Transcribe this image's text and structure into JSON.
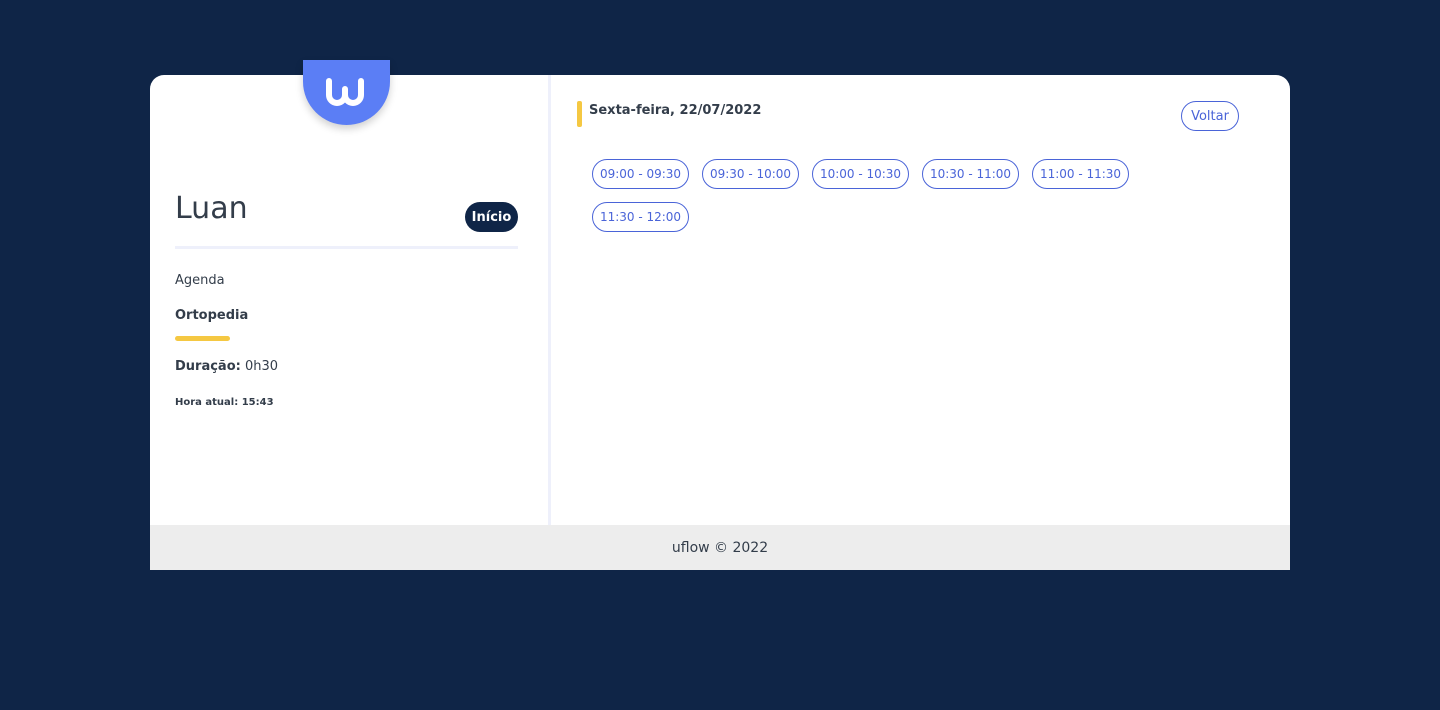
{
  "logo": {
    "icon": "uflow-logo-icon",
    "color": "#5b7ef5"
  },
  "sidebar": {
    "user_name": "Luan",
    "home_button_label": "Início",
    "agenda_label": "Agenda",
    "specialty": "Ortopedia",
    "duration_label": "Duração:",
    "duration_value": "0h30",
    "current_time": "Hora atual: 15:43"
  },
  "schedule": {
    "date": "Sexta-feira, 22/07/2022",
    "back_label": "Voltar",
    "slots": [
      {
        "label": "09:00 - 09:30"
      },
      {
        "label": "09:30 - 10:00"
      },
      {
        "label": "10:00 - 10:30"
      },
      {
        "label": "10:30 - 11:00"
      },
      {
        "label": "11:00 - 11:30"
      },
      {
        "label": "11:30 - 12:00"
      }
    ]
  },
  "footer": {
    "text": "uflow © 2022"
  },
  "colors": {
    "background": "#0f2547",
    "accent": "#4a64d8",
    "highlight": "#f5c842"
  }
}
